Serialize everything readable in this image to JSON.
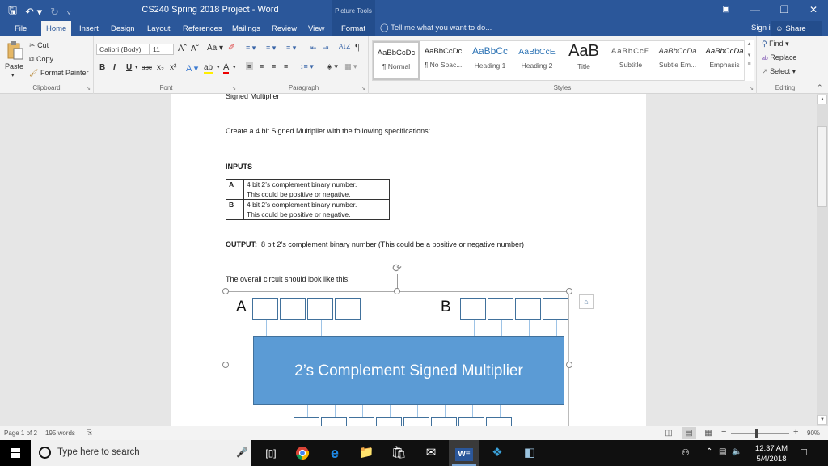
{
  "titlebar": {
    "title": "CS240 Spring 2018 Project - Word",
    "contextual_group": "Picture Tools",
    "qat": {
      "save_icon": "save-icon",
      "undo_icon": "undo-icon",
      "redo_icon": "redo-icon",
      "customize_icon": "customize-qat-icon"
    },
    "window_controls": [
      "ribbon-display-options",
      "minimize",
      "restore",
      "close"
    ]
  },
  "tabs": [
    {
      "label": "File"
    },
    {
      "label": "Home",
      "active": true
    },
    {
      "label": "Insert"
    },
    {
      "label": "Design"
    },
    {
      "label": "Layout"
    },
    {
      "label": "References"
    },
    {
      "label": "Mailings"
    },
    {
      "label": "Review"
    },
    {
      "label": "View"
    },
    {
      "label": "Format",
      "contextual": true
    }
  ],
  "tell_me": "Tell me what you want to do...",
  "sign_in": "Sign in",
  "share": "Share",
  "ribbon": {
    "clipboard": {
      "label": "Clipboard",
      "paste": "Paste",
      "cut": "Cut",
      "copy": "Copy",
      "format_painter": "Format Painter"
    },
    "font": {
      "label": "Font",
      "font_name": "Calibri (Body)",
      "font_size": "11",
      "grow": "Aˆ",
      "shrink": "Aˇ",
      "change_case": "Aa",
      "bold": "B",
      "italic": "I",
      "underline": "U",
      "strikethrough": "abc",
      "subscript": "x₂",
      "superscript": "x²"
    },
    "paragraph": {
      "label": "Paragraph",
      "sort": "A↓Z",
      "pilcrow": "¶"
    },
    "styles": {
      "label": "Styles",
      "items": [
        {
          "preview": "AaBbCcDc",
          "name": "¶ Normal",
          "selected": true
        },
        {
          "preview": "AaBbCcDc",
          "name": "¶ No Spac..."
        },
        {
          "preview": "AaBbCc",
          "name": "Heading 1"
        },
        {
          "preview": "AaBbCcE",
          "name": "Heading 2"
        },
        {
          "preview": "AaB",
          "name": "Title"
        },
        {
          "preview": "AaBbCcE",
          "name": "Subtitle"
        },
        {
          "preview": "AaBbCcDa",
          "name": "Subtle Em..."
        },
        {
          "preview": "AaBbCcDa",
          "name": "Emphasis"
        }
      ]
    },
    "editing": {
      "label": "Editing",
      "find": "Find",
      "replace": "Replace",
      "select": "Select"
    }
  },
  "document": {
    "heading_cut": "Signed Multiplier",
    "intro": "Create a 4 bit Signed Multiplier with the following specifications:",
    "inputs_heading": "INPUTS",
    "inputs_table": [
      {
        "key": "A",
        "line1": "4 bit 2’s complement binary number.",
        "line2": "This could be positive or negative."
      },
      {
        "key": "B",
        "line1": "4 bit 2’s complement binary number.",
        "line2": "This could be positive or negative."
      }
    ],
    "output_label": "OUTPUT:",
    "output_text": "8 bit 2’s complement binary number (This could be a positive or negative number)",
    "circuit_intro": "The overall circuit should look like this:",
    "diagram": {
      "input_a_label": "A",
      "input_b_label": "B",
      "input_bits": 4,
      "output_bits": 8,
      "block_label": "2’s Complement Signed Multiplier",
      "block_color": "#5b9bd5"
    }
  },
  "statusbar": {
    "page": "Page 1 of 2",
    "words": "195 words",
    "zoom": "90%",
    "zoom_value_percent": 90
  },
  "taskbar": {
    "search_placeholder": "Type here to search",
    "time": "12:37 AM",
    "date": "5/4/2018",
    "apps": [
      "task-view",
      "chrome",
      "edge",
      "file-explorer",
      "store",
      "mail",
      "word",
      "kodi",
      "notepad"
    ]
  }
}
